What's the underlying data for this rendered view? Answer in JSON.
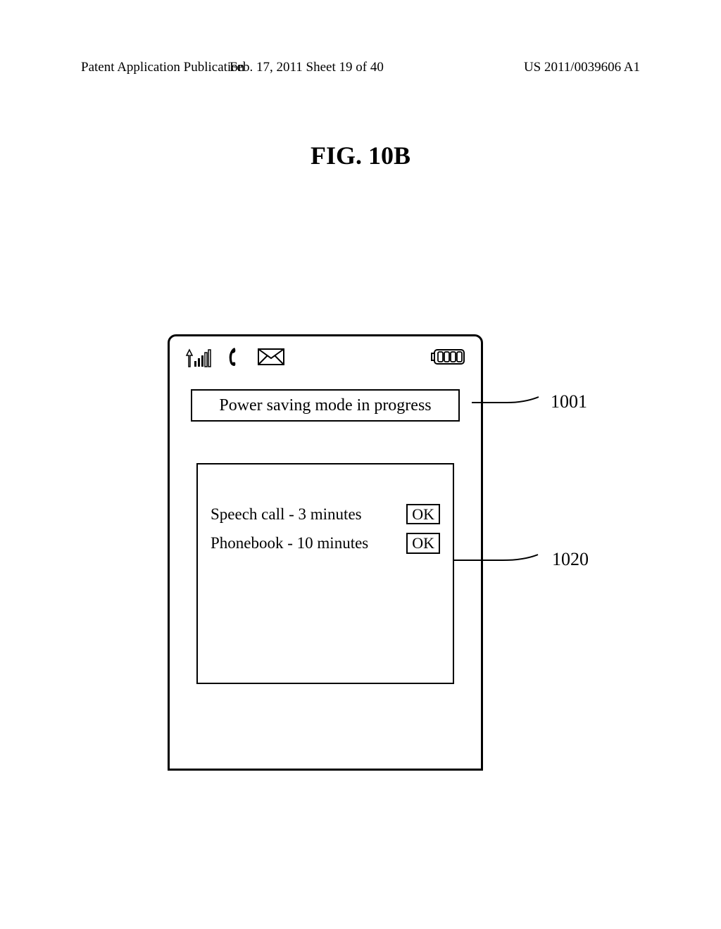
{
  "header": {
    "left": "Patent Application Publication",
    "center": "Feb. 17, 2011  Sheet 19 of 40",
    "right": "US 2011/0039606 A1"
  },
  "figure": {
    "title": "FIG. 10B"
  },
  "phone": {
    "title_text": "Power saving mode in progress",
    "rows": [
      {
        "label": "Speech call - 3 minutes",
        "button": "OK"
      },
      {
        "label": "Phonebook - 10 minutes",
        "button": "OK"
      }
    ]
  },
  "callouts": {
    "c1001": "1001",
    "c1020": "1020"
  }
}
